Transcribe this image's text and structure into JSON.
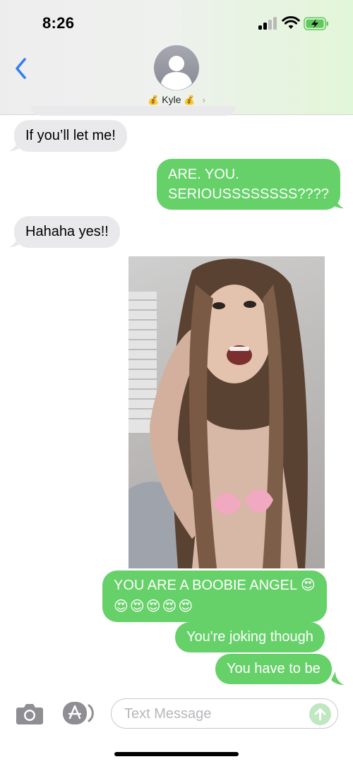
{
  "status_bar": {
    "time": "8:26"
  },
  "header": {
    "back_label": "‹",
    "contact_name": "Kyle",
    "contact_prefix_emoji": "💰",
    "contact_suffix_emoji": "💰",
    "contact_chevron": "›",
    "icons": [
      "chevron-left-icon",
      "person-icon",
      "signal-icon",
      "wifi-icon",
      "battery-charging-icon"
    ]
  },
  "messages": [
    {
      "side": "received",
      "text": "If you’ll let me!"
    },
    {
      "side": "sent",
      "line1": "ARE. YOU.",
      "line2": "SERIOUSSSSSSSS????"
    },
    {
      "side": "received",
      "text": "Hahaha yes!!"
    },
    {
      "side": "sent",
      "type": "photo"
    },
    {
      "side": "sent",
      "line1": "YOU ARE A BOOBIE ANGEL 😍",
      "line2": "😍😍😍😍😍"
    },
    {
      "side": "sent",
      "text": "You're joking though"
    },
    {
      "side": "sent",
      "text": "You have to be"
    }
  ],
  "compose": {
    "placeholder": "Text Message",
    "icons": [
      "camera-icon",
      "app-store-icon",
      "send-arrow-icon"
    ]
  },
  "colors": {
    "sent_bubble": "#65d168",
    "received_bubble": "#e9e9eb",
    "accent_blue": "#2f7cf6"
  }
}
